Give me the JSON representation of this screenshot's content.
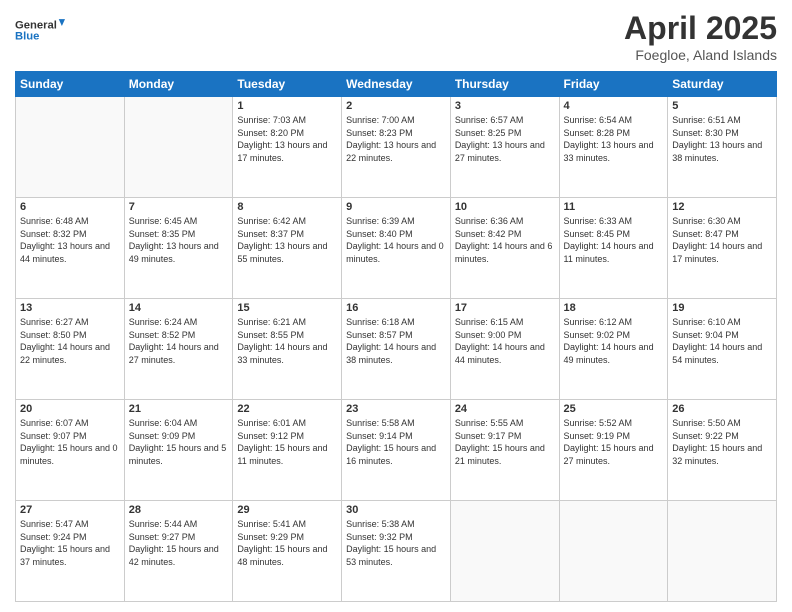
{
  "logo": {
    "line1": "General",
    "line2": "Blue"
  },
  "title": "April 2025",
  "subtitle": "Foegloe, Aland Islands",
  "weekdays": [
    "Sunday",
    "Monday",
    "Tuesday",
    "Wednesday",
    "Thursday",
    "Friday",
    "Saturday"
  ],
  "weeks": [
    [
      {
        "day": "",
        "info": ""
      },
      {
        "day": "",
        "info": ""
      },
      {
        "day": "1",
        "info": "Sunrise: 7:03 AM\nSunset: 8:20 PM\nDaylight: 13 hours\nand 17 minutes."
      },
      {
        "day": "2",
        "info": "Sunrise: 7:00 AM\nSunset: 8:23 PM\nDaylight: 13 hours\nand 22 minutes."
      },
      {
        "day": "3",
        "info": "Sunrise: 6:57 AM\nSunset: 8:25 PM\nDaylight: 13 hours\nand 27 minutes."
      },
      {
        "day": "4",
        "info": "Sunrise: 6:54 AM\nSunset: 8:28 PM\nDaylight: 13 hours\nand 33 minutes."
      },
      {
        "day": "5",
        "info": "Sunrise: 6:51 AM\nSunset: 8:30 PM\nDaylight: 13 hours\nand 38 minutes."
      }
    ],
    [
      {
        "day": "6",
        "info": "Sunrise: 6:48 AM\nSunset: 8:32 PM\nDaylight: 13 hours\nand 44 minutes."
      },
      {
        "day": "7",
        "info": "Sunrise: 6:45 AM\nSunset: 8:35 PM\nDaylight: 13 hours\nand 49 minutes."
      },
      {
        "day": "8",
        "info": "Sunrise: 6:42 AM\nSunset: 8:37 PM\nDaylight: 13 hours\nand 55 minutes."
      },
      {
        "day": "9",
        "info": "Sunrise: 6:39 AM\nSunset: 8:40 PM\nDaylight: 14 hours\nand 0 minutes."
      },
      {
        "day": "10",
        "info": "Sunrise: 6:36 AM\nSunset: 8:42 PM\nDaylight: 14 hours\nand 6 minutes."
      },
      {
        "day": "11",
        "info": "Sunrise: 6:33 AM\nSunset: 8:45 PM\nDaylight: 14 hours\nand 11 minutes."
      },
      {
        "day": "12",
        "info": "Sunrise: 6:30 AM\nSunset: 8:47 PM\nDaylight: 14 hours\nand 17 minutes."
      }
    ],
    [
      {
        "day": "13",
        "info": "Sunrise: 6:27 AM\nSunset: 8:50 PM\nDaylight: 14 hours\nand 22 minutes."
      },
      {
        "day": "14",
        "info": "Sunrise: 6:24 AM\nSunset: 8:52 PM\nDaylight: 14 hours\nand 27 minutes."
      },
      {
        "day": "15",
        "info": "Sunrise: 6:21 AM\nSunset: 8:55 PM\nDaylight: 14 hours\nand 33 minutes."
      },
      {
        "day": "16",
        "info": "Sunrise: 6:18 AM\nSunset: 8:57 PM\nDaylight: 14 hours\nand 38 minutes."
      },
      {
        "day": "17",
        "info": "Sunrise: 6:15 AM\nSunset: 9:00 PM\nDaylight: 14 hours\nand 44 minutes."
      },
      {
        "day": "18",
        "info": "Sunrise: 6:12 AM\nSunset: 9:02 PM\nDaylight: 14 hours\nand 49 minutes."
      },
      {
        "day": "19",
        "info": "Sunrise: 6:10 AM\nSunset: 9:04 PM\nDaylight: 14 hours\nand 54 minutes."
      }
    ],
    [
      {
        "day": "20",
        "info": "Sunrise: 6:07 AM\nSunset: 9:07 PM\nDaylight: 15 hours\nand 0 minutes."
      },
      {
        "day": "21",
        "info": "Sunrise: 6:04 AM\nSunset: 9:09 PM\nDaylight: 15 hours\nand 5 minutes."
      },
      {
        "day": "22",
        "info": "Sunrise: 6:01 AM\nSunset: 9:12 PM\nDaylight: 15 hours\nand 11 minutes."
      },
      {
        "day": "23",
        "info": "Sunrise: 5:58 AM\nSunset: 9:14 PM\nDaylight: 15 hours\nand 16 minutes."
      },
      {
        "day": "24",
        "info": "Sunrise: 5:55 AM\nSunset: 9:17 PM\nDaylight: 15 hours\nand 21 minutes."
      },
      {
        "day": "25",
        "info": "Sunrise: 5:52 AM\nSunset: 9:19 PM\nDaylight: 15 hours\nand 27 minutes."
      },
      {
        "day": "26",
        "info": "Sunrise: 5:50 AM\nSunset: 9:22 PM\nDaylight: 15 hours\nand 32 minutes."
      }
    ],
    [
      {
        "day": "27",
        "info": "Sunrise: 5:47 AM\nSunset: 9:24 PM\nDaylight: 15 hours\nand 37 minutes."
      },
      {
        "day": "28",
        "info": "Sunrise: 5:44 AM\nSunset: 9:27 PM\nDaylight: 15 hours\nand 42 minutes."
      },
      {
        "day": "29",
        "info": "Sunrise: 5:41 AM\nSunset: 9:29 PM\nDaylight: 15 hours\nand 48 minutes."
      },
      {
        "day": "30",
        "info": "Sunrise: 5:38 AM\nSunset: 9:32 PM\nDaylight: 15 hours\nand 53 minutes."
      },
      {
        "day": "",
        "info": ""
      },
      {
        "day": "",
        "info": ""
      },
      {
        "day": "",
        "info": ""
      }
    ]
  ]
}
